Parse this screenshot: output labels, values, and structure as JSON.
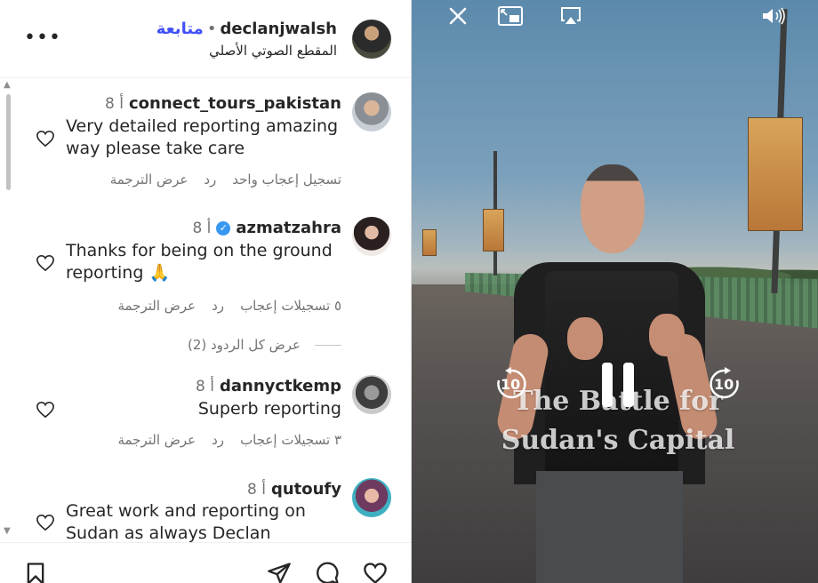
{
  "header": {
    "username": "declanjwalsh",
    "separator": "•",
    "follow_label": "متابعة",
    "audio_label": "المقطع الصوتي الأصلي",
    "more_label": "•••"
  },
  "comments": [
    {
      "username": "connect_tours_pakistan",
      "time": "8 أ",
      "text": "Very detailed reporting amazing way please take care",
      "likes_label": "تسجيل إعجاب واحد",
      "reply_label": "رد",
      "translate_label": "عرض الترجمة"
    },
    {
      "username": "azmatzahra",
      "time": "8 أ",
      "text": "Thanks for being on the ground reporting 🙏",
      "likes_label": "٥ تسجيلات إعجاب",
      "reply_label": "رد",
      "translate_label": "عرض الترجمة"
    },
    {
      "username": "dannyctkemp",
      "time": "8 أ",
      "text": "Superb reporting",
      "likes_label": "٣ تسجيلات إعجاب",
      "reply_label": "رد",
      "translate_label": "عرض الترجمة"
    },
    {
      "username": "qutoufy",
      "time": "8 أ",
      "text": "Great work and reporting on Sudan as always Declan"
    }
  ],
  "view_replies_label": "عرض كل الردود (2)",
  "video": {
    "caption": "The Battle for Sudan's Capital",
    "rewind_label": "10",
    "forward_label": "10"
  },
  "icons": {
    "close": "close-icon",
    "pip": "picture-in-picture-icon",
    "airplay": "airplay-icon",
    "volume": "volume-icon",
    "pause": "pause-icon",
    "bookmark": "bookmark-icon",
    "share": "share-icon",
    "comment": "comment-icon",
    "like": "heart-icon"
  },
  "colors": {
    "follow_accent": "#4150f7",
    "verified_badge": "#3897f0"
  }
}
